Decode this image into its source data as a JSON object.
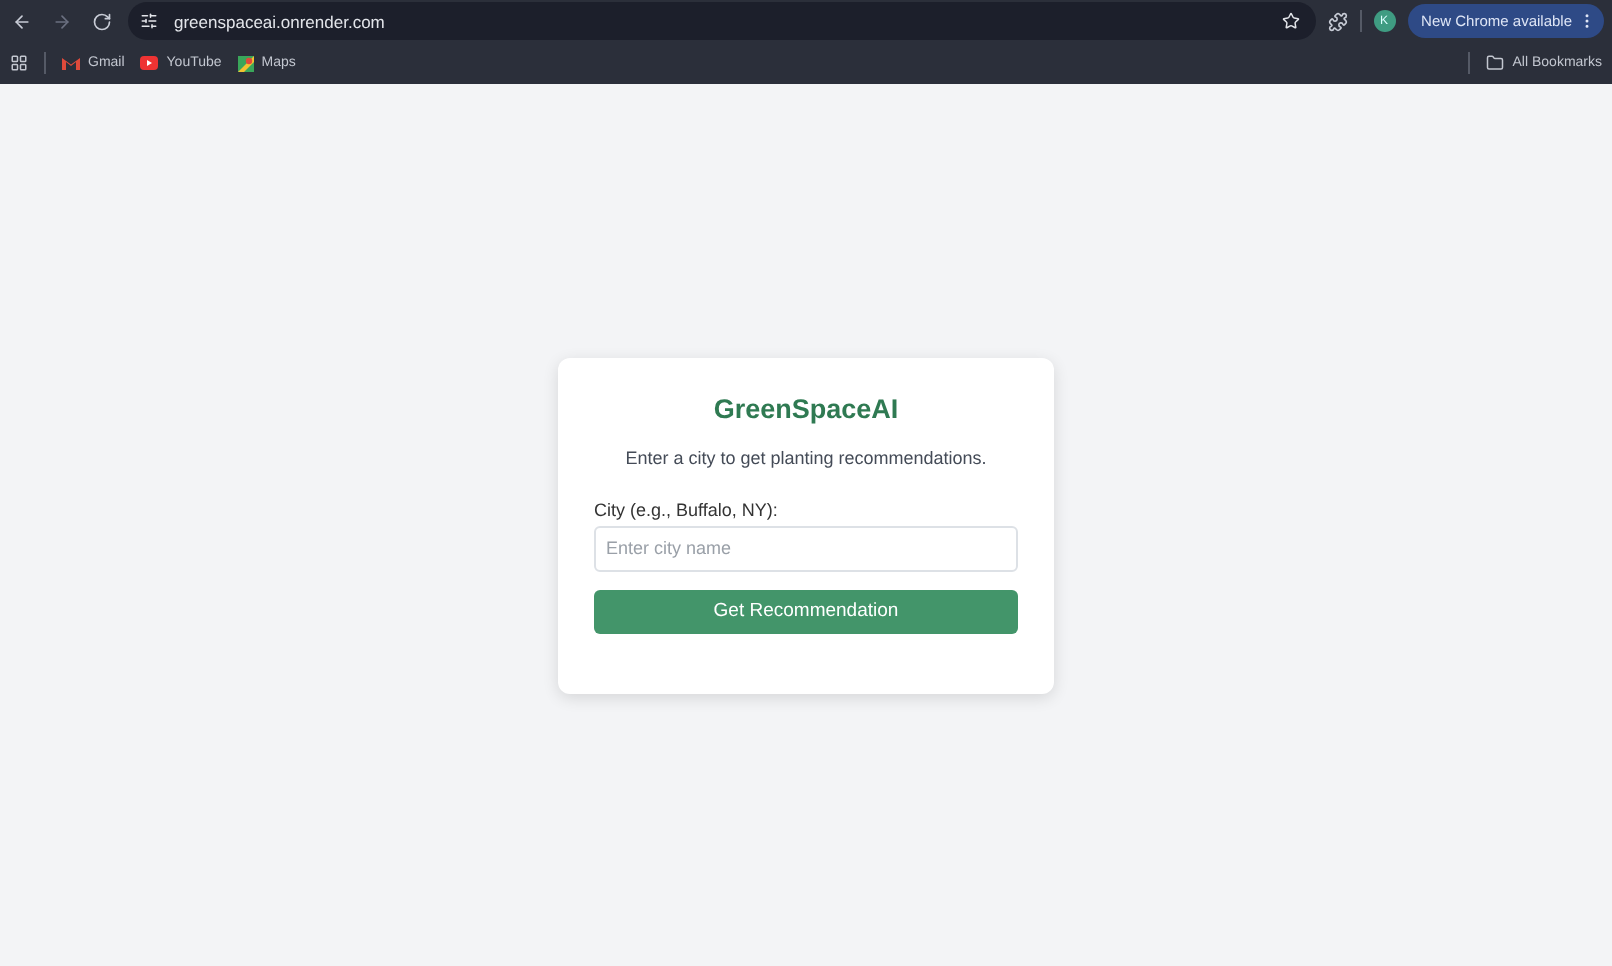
{
  "browser": {
    "nav": [
      {
        "kind": "back",
        "disabled": false
      },
      {
        "kind": "forward",
        "disabled": true
      },
      {
        "kind": "reload",
        "disabled": false
      }
    ],
    "url": "greenspaceai.onrender.com",
    "profile": "K",
    "update_button": "New Chrome available",
    "bookmarks": [
      {
        "kind": "gmail",
        "label": "Gmail"
      },
      {
        "kind": "youtube",
        "label": "YouTube"
      },
      {
        "kind": "maps",
        "label": "Maps"
      }
    ],
    "all_bookmarks": "All Bookmarks"
  },
  "card": {
    "title": "GreenSpaceAI",
    "subtitle": "Enter a city to get planting recommendations.",
    "field_label": "City (e.g., Buffalo, NY):",
    "placeholder": "Enter city name",
    "button": "Get Recommendation"
  }
}
